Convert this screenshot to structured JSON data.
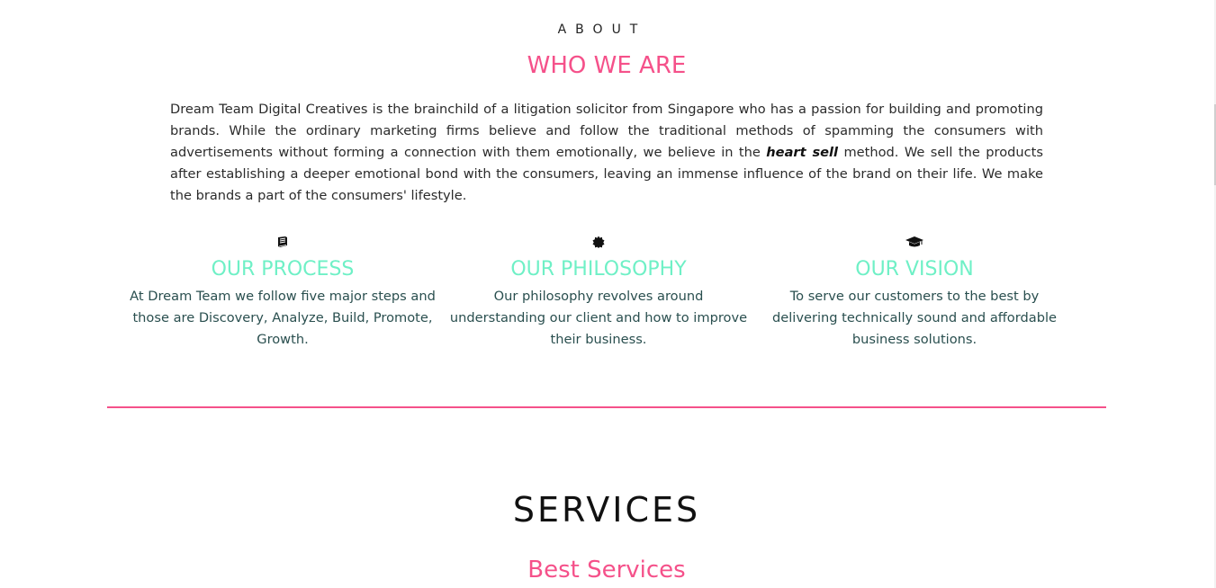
{
  "about": {
    "eyebrow": "ABOUT",
    "title": "WHO WE ARE",
    "text_before": "Dream Team Digital Creatives is the brainchild of a litigation solicitor from Singapore who has a passion for building and promoting brands. While the ordinary marketing firms believe and follow the traditional methods of spamming the consumers with advertisements without forming a connection with them emotionally, we believe in the ",
    "emphasis": "heart sell",
    "text_after": " method. We sell the products after establishing a deeper emotional bond with the consumers, leaving an immense influence of the brand on their life. We make the brands a part of the consumers' lifestyle."
  },
  "features": [
    {
      "icon": "book-icon",
      "title": "OUR PROCESS",
      "text": "At Dream Team we follow five major steps and those are Discovery, Analyze, Build, Promote, Growth."
    },
    {
      "icon": "badge-icon",
      "title": "OUR PHILOSOPHY",
      "text": "Our philosophy revolves around understanding our client and how to improve their business."
    },
    {
      "icon": "graduation-cap-icon",
      "title": "OUR VISION",
      "text": "To serve our customers to the best by delivering technically sound and affordable business solutions."
    }
  ],
  "services": {
    "title": "SERVICES",
    "subtitle": "Best Services"
  },
  "colors": {
    "accent_pink": "#f5518a",
    "accent_mint": "#6ff0c6",
    "body_text": "#2b2b2b",
    "feature_text": "#2a4f4f"
  }
}
